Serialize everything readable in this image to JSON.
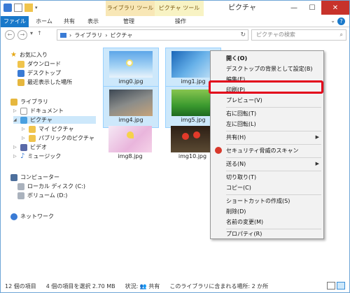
{
  "window": {
    "title": "ピクチャ",
    "context_tab_library": "ライブラリ ツール",
    "context_tab_picture": "ピクチャ ツール"
  },
  "ribbon": {
    "tabs": [
      "ファイル",
      "ホーム",
      "共有",
      "表示",
      "管理",
      "操作"
    ]
  },
  "address": {
    "path": [
      "ライブラリ",
      "ピクチャ"
    ],
    "search_placeholder": "ピクチャの検索"
  },
  "navpane": {
    "favorites": "お気に入り",
    "downloads": "ダウンロード",
    "desktop": "デスクトップ",
    "recent": "最近表示した場所",
    "libraries": "ライブラリ",
    "documents": "ドキュメント",
    "pictures": "ピクチャ",
    "my_pictures": "マイ ピクチャ",
    "public_pictures": "パブリックのピクチャ",
    "video": "ビデオ",
    "music": "ミュージック",
    "computer": "コンピューター",
    "local_disk": "ローカル ディスク (C:)",
    "volume": "ボリューム (D:)",
    "network": "ネットワーク"
  },
  "files": [
    {
      "name": "img0.jpg",
      "selected": true
    },
    {
      "name": "img1.jpg",
      "selected": true
    },
    {
      "name": "img4.jpg",
      "selected": true
    },
    {
      "name": "img5.jpg",
      "selected": true
    },
    {
      "name": "img8.jpg",
      "selected": false
    },
    {
      "name": "img10.jpg",
      "selected": false
    }
  ],
  "context_menu": {
    "items": [
      "開く(O)",
      "デスクトップの背景として設定(B)",
      "編集(E)",
      "印刷(P)",
      "プレビュー(V)",
      "右に回転(T)",
      "左に回転(L)",
      "共有(H)",
      "セキュリティ脅威のスキャン",
      "送る(N)",
      "切り取り(T)",
      "コピー(C)",
      "ショートカットの作成(S)",
      "削除(D)",
      "名前の変更(M)",
      "プロパティ(R)"
    ],
    "highlighted": "印刷(P)"
  },
  "status": {
    "count": "12 個の項目",
    "selected": "4 個の項目を選択 2.70 MB",
    "state": "状況:",
    "share": "共有",
    "included": "このライブラリに含まれる場所: 2 か所"
  },
  "colors": {
    "accent": "#1979ca",
    "selection": "#cde8fb",
    "highlight_border": "#e2001a"
  }
}
